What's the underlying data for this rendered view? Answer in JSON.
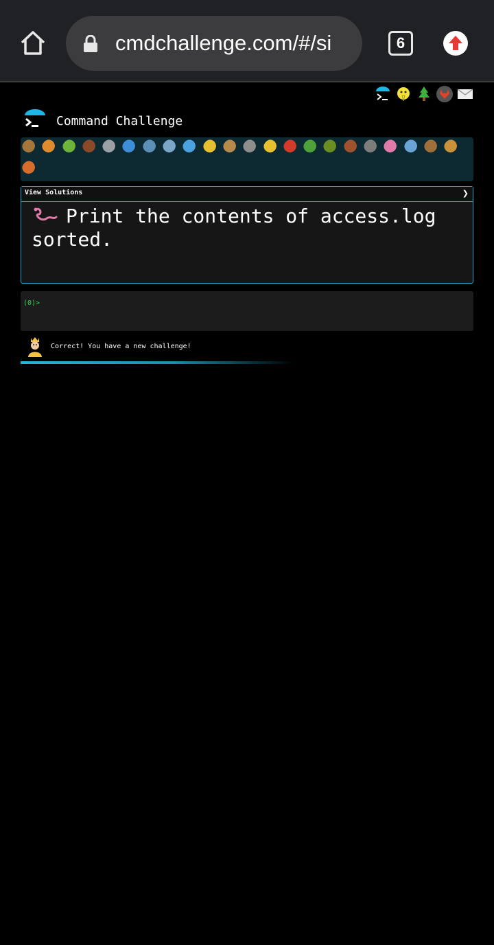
{
  "browser": {
    "url": "cmdchallenge.com/#/si",
    "tab_count": "6"
  },
  "header": {
    "title": "Command Challenge",
    "social_icons": [
      "terminal-icon",
      "bird-icon",
      "tree-icon",
      "gitlab-icon",
      "mail-icon"
    ]
  },
  "critters": {
    "row1": [
      "snail",
      "butterfly",
      "caterpillar",
      "ant",
      "spider-web",
      "whale",
      "shark",
      "dolphin",
      "fish",
      "tropical-fish",
      "blowfish",
      "wolf",
      "bee",
      "ladybug",
      "lizard",
      "bug",
      "scorpion",
      "fly",
      "worm",
      "sausage",
      "monkey",
      "dog"
    ],
    "row2": [
      "fox"
    ]
  },
  "challenge": {
    "view_solutions_label": "View Solutions",
    "chevron": "❯",
    "task_text": "Print the contents of access.log sorted."
  },
  "terminal": {
    "prompt": "(0)>"
  },
  "status": {
    "message": "Correct! You have a new challenge!"
  },
  "colors": {
    "accent": "#2aa6c6",
    "prompt_green": "#39d353",
    "critter_bar_bg": "#0d2a33"
  }
}
